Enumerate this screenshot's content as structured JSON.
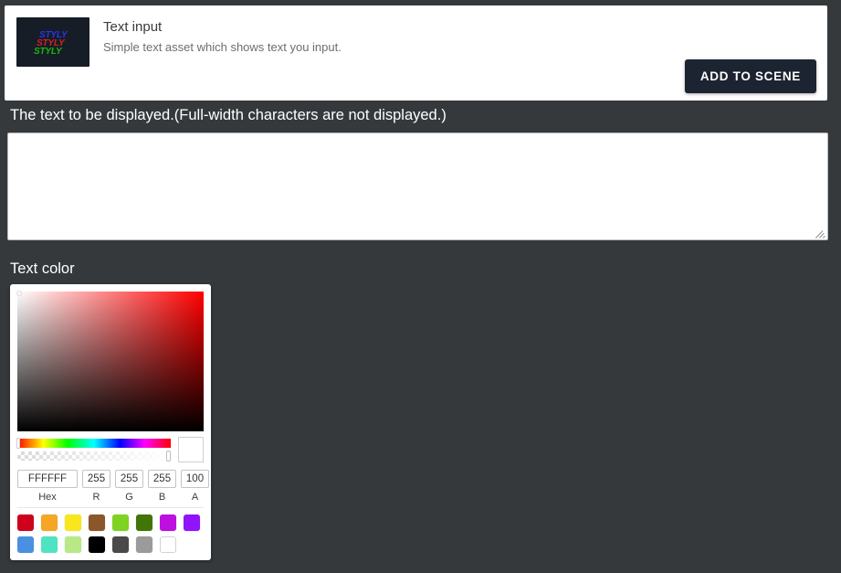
{
  "asset": {
    "title": "Text input",
    "description": "Simple text asset which shows text you input.",
    "thumbnail": {
      "line1": "STYLY",
      "line2": "STYLY",
      "line3": "STYLY",
      "color1": "#2a35e8",
      "color2": "#d61f1f",
      "color3": "#16b80e",
      "background": "#161d26"
    },
    "add_button_label": "ADD TO SCENE"
  },
  "text_field": {
    "label": "The text to be displayed.(Full-width characters are not displayed.)",
    "value": "",
    "placeholder": ""
  },
  "color_section": {
    "label": "Text color",
    "picker": {
      "hex": "FFFFFF",
      "r": "255",
      "g": "255",
      "b": "255",
      "a": "100",
      "hex_label": "Hex",
      "r_label": "R",
      "g_label": "G",
      "b_label": "B",
      "a_label": "A",
      "preview_color": "#ffffff",
      "hue": 0,
      "saturation": 0,
      "value": 100,
      "swatch_rows": [
        [
          "#d0021b",
          "#f5a623",
          "#f8e71c",
          "#8b572a",
          "#7ed321",
          "#417505",
          "#bd10e0",
          "#9013fe"
        ],
        [
          "#4a90e2",
          "#50e3c2",
          "#b8e986",
          "#000000",
          "#4a4a4a",
          "#9b9b9b",
          "#ffffff"
        ]
      ]
    }
  }
}
